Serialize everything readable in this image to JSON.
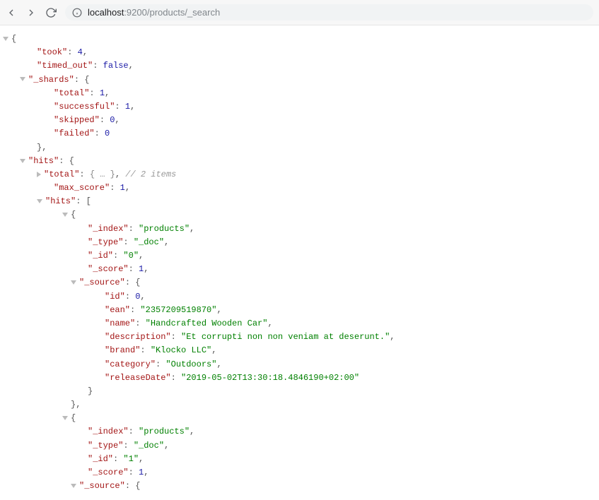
{
  "toolbar": {
    "url_host": "localhost",
    "url_port": ":9200",
    "url_path": "/products/_search"
  },
  "json": {
    "took_key": "\"took\"",
    "took_val": "4",
    "timed_out_key": "\"timed_out\"",
    "timed_out_val": "false",
    "shards_key": "\"_shards\"",
    "shards_total_key": "\"total\"",
    "shards_total_val": "1",
    "shards_successful_key": "\"successful\"",
    "shards_successful_val": "1",
    "shards_skipped_key": "\"skipped\"",
    "shards_skipped_val": "0",
    "shards_failed_key": "\"failed\"",
    "shards_failed_val": "0",
    "hits_key": "\"hits\"",
    "hits_total_key": "\"total\"",
    "hits_total_ellipsis": "{ … }",
    "hits_total_comment": "// 2 items",
    "hits_max_score_key": "\"max_score\"",
    "hits_max_score_val": "1",
    "hits_hits_key": "\"hits\"",
    "hit0_index_key": "\"_index\"",
    "hit0_index_val": "\"products\"",
    "hit0_type_key": "\"_type\"",
    "hit0_type_val": "\"_doc\"",
    "hit0_id_key": "\"_id\"",
    "hit0_id_val": "\"0\"",
    "hit0_score_key": "\"_score\"",
    "hit0_score_val": "1",
    "hit0_source_key": "\"_source\"",
    "src0_id_key": "\"id\"",
    "src0_id_val": "0",
    "src0_ean_key": "\"ean\"",
    "src0_ean_val": "\"2357209519870\"",
    "src0_name_key": "\"name\"",
    "src0_name_val": "\"Handcrafted Wooden Car\"",
    "src0_desc_key": "\"description\"",
    "src0_desc_val": "\"Et corrupti non non veniam at deserunt.\"",
    "src0_brand_key": "\"brand\"",
    "src0_brand_val": "\"Klocko LLC\"",
    "src0_cat_key": "\"category\"",
    "src0_cat_val": "\"Outdoors\"",
    "src0_rel_key": "\"releaseDate\"",
    "src0_rel_val": "\"2019-05-02T13:30:18.4846190+02:00\"",
    "hit1_index_key": "\"_index\"",
    "hit1_index_val": "\"products\"",
    "hit1_type_key": "\"_type\"",
    "hit1_type_val": "\"_doc\"",
    "hit1_id_key": "\"_id\"",
    "hit1_id_val": "\"1\"",
    "hit1_score_key": "\"_score\"",
    "hit1_score_val": "1",
    "hit1_source_key": "\"_source\""
  }
}
